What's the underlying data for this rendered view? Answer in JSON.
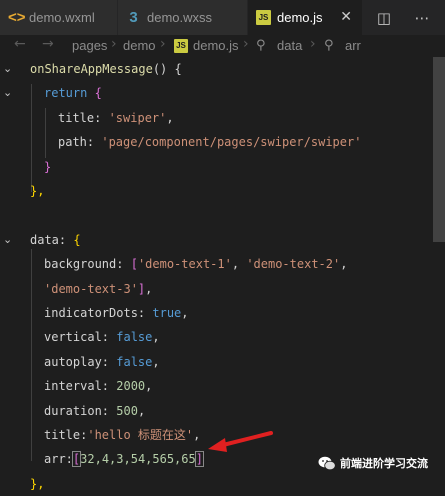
{
  "tabs": [
    {
      "label": "demo.wxml",
      "icon": "wxml-file-icon",
      "active": false
    },
    {
      "label": "demo.wxss",
      "icon": "wxss-file-icon",
      "active": false
    },
    {
      "label": "demo.js",
      "icon": "js-file-icon",
      "active": true
    }
  ],
  "tab_actions": {
    "split_icon": "split-editor-icon",
    "more_icon": "more-actions-icon"
  },
  "breadcrumb": [
    "pages",
    "demo",
    "demo.js",
    "data",
    "arr"
  ],
  "code": {
    "l1_fn": "onShareAppMessage",
    "l1_rest": "() {",
    "l2_kw": "return",
    "l2_brace": "{",
    "l3_key": "title: ",
    "l3_str": "'swiper'",
    "l3_end": ",",
    "l4_key": "path: ",
    "l4_str": "'page/component/pages/swiper/swiper'",
    "l5_brace": "}",
    "l6": "},",
    "l8_key": "data: ",
    "l8_brace": "{",
    "l9_key": "background: ",
    "l9_br": "[",
    "l9_s1": "'demo-text-1'",
    "l9_c1": ", ",
    "l9_s2": "'demo-text-2'",
    "l9_c2": ",",
    "l10_s3": "'demo-text-3'",
    "l10_br": "]",
    "l10_end": ",",
    "l11_key": "indicatorDots: ",
    "l11_val": "true",
    "l11_end": ",",
    "l12_key": "vertical: ",
    "l12_val": "false",
    "l12_end": ",",
    "l13_key": "autoplay: ",
    "l13_val": "false",
    "l13_end": ",",
    "l14_key": "interval: ",
    "l14_val": "2000",
    "l14_end": ",",
    "l15_key": "duration: ",
    "l15_val": "500",
    "l15_end": ",",
    "l16_key": "title:",
    "l16_str": "'hello 标题在这'",
    "l16_end": ",",
    "l17_key": "arr:",
    "l17_br_open": "[",
    "l17_vals": "32,4,3,54,565,65",
    "l17_br_close": "]",
    "l18": "},"
  },
  "colors": {
    "accent_arrow": "#e02020",
    "background": "#1e1e1e"
  },
  "watermark": {
    "icon": "wechat-icon",
    "text": "前端进阶学习交流"
  }
}
